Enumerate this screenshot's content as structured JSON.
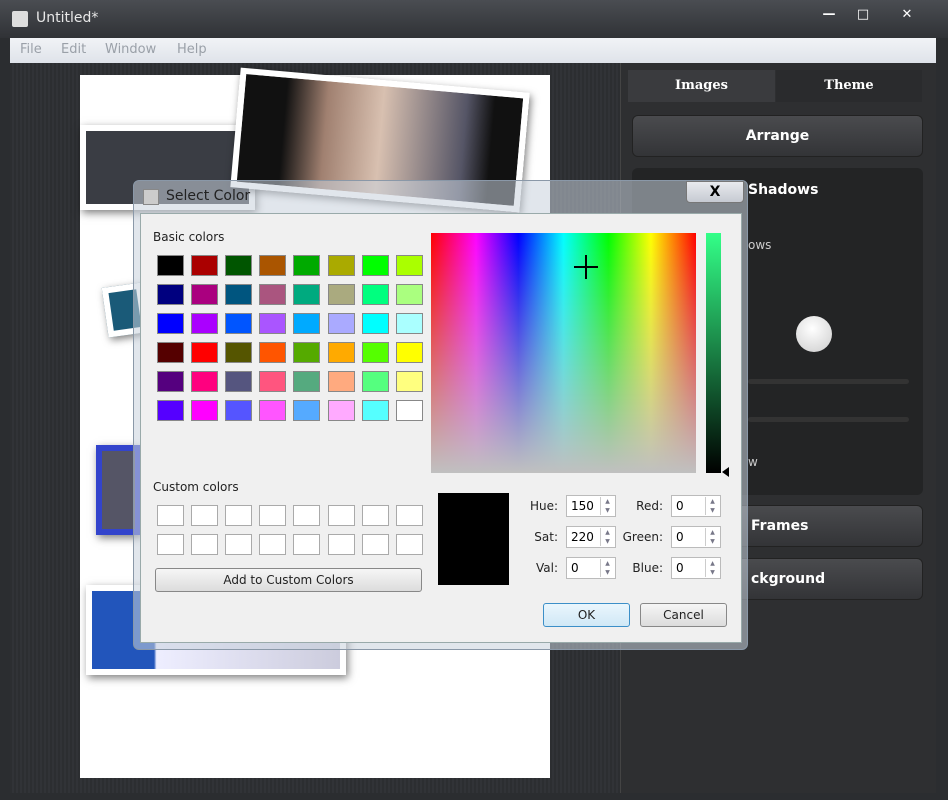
{
  "window": {
    "title": "Untitled*",
    "controls": [
      "—",
      "□",
      "✕"
    ]
  },
  "menu": [
    "File",
    "Edit",
    "Window",
    "Help"
  ],
  "panel": {
    "tabs": [
      "Images",
      "Theme"
    ],
    "arrange": "Arrange",
    "shadows": "Shadows",
    "shadows_option": "ows",
    "shadows_option2": "w",
    "frames": "Frames",
    "background": "ckground"
  },
  "dialog": {
    "title": "Select Color",
    "close": "X",
    "basic_colors_label": "Basic colors",
    "basic_colors": [
      "#000000",
      "#aa0000",
      "#005500",
      "#aa5500",
      "#00aa00",
      "#aaaa00",
      "#00ff00",
      "#aaff00",
      "#00007f",
      "#aa007f",
      "#00557f",
      "#aa557f",
      "#00aa7f",
      "#aaaa7f",
      "#00ff7f",
      "#aaff7f",
      "#0000ff",
      "#aa00ff",
      "#0055ff",
      "#aa55ff",
      "#00aaff",
      "#aaaaff",
      "#00ffff",
      "#aaffff",
      "#550000",
      "#ff0000",
      "#555500",
      "#ff5500",
      "#55aa00",
      "#ffaa00",
      "#55ff00",
      "#ffff00",
      "#55007f",
      "#ff007f",
      "#55557f",
      "#ff557f",
      "#55aa7f",
      "#ffaa7f",
      "#55ff7f",
      "#ffff7f",
      "#5500ff",
      "#ff00ff",
      "#5555ff",
      "#ff55ff",
      "#55aaff",
      "#ffaaff",
      "#55ffff",
      "#ffffff"
    ],
    "custom_colors_label": "Custom colors",
    "add_custom": "Add to Custom Colors",
    "fields": {
      "hue_label": "Hue:",
      "hue": "150",
      "sat_label": "Sat:",
      "sat": "220",
      "val_label": "Val:",
      "val": "0",
      "red_label": "Red:",
      "red": "0",
      "green_label": "Green:",
      "green": "0",
      "blue_label": "Blue:",
      "blue": "0"
    },
    "current_color": "#000000",
    "ok": "OK",
    "cancel": "Cancel"
  }
}
